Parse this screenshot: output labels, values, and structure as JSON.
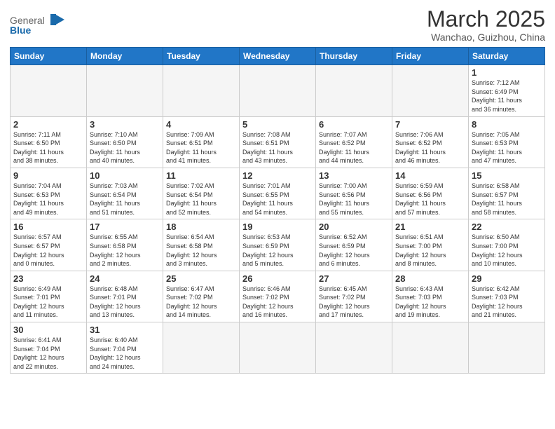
{
  "header": {
    "logo_general": "General",
    "logo_blue": "Blue",
    "month_title": "March 2025",
    "location": "Wanchao, Guizhou, China"
  },
  "weekdays": [
    "Sunday",
    "Monday",
    "Tuesday",
    "Wednesday",
    "Thursday",
    "Friday",
    "Saturday"
  ],
  "weeks": [
    [
      {
        "day": "",
        "info": ""
      },
      {
        "day": "",
        "info": ""
      },
      {
        "day": "",
        "info": ""
      },
      {
        "day": "",
        "info": ""
      },
      {
        "day": "",
        "info": ""
      },
      {
        "day": "",
        "info": ""
      },
      {
        "day": "1",
        "info": "Sunrise: 7:12 AM\nSunset: 6:49 PM\nDaylight: 11 hours\nand 36 minutes."
      }
    ],
    [
      {
        "day": "2",
        "info": "Sunrise: 7:11 AM\nSunset: 6:50 PM\nDaylight: 11 hours\nand 38 minutes."
      },
      {
        "day": "3",
        "info": "Sunrise: 7:10 AM\nSunset: 6:50 PM\nDaylight: 11 hours\nand 40 minutes."
      },
      {
        "day": "4",
        "info": "Sunrise: 7:09 AM\nSunset: 6:51 PM\nDaylight: 11 hours\nand 41 minutes."
      },
      {
        "day": "5",
        "info": "Sunrise: 7:08 AM\nSunset: 6:51 PM\nDaylight: 11 hours\nand 43 minutes."
      },
      {
        "day": "6",
        "info": "Sunrise: 7:07 AM\nSunset: 6:52 PM\nDaylight: 11 hours\nand 44 minutes."
      },
      {
        "day": "7",
        "info": "Sunrise: 7:06 AM\nSunset: 6:52 PM\nDaylight: 11 hours\nand 46 minutes."
      },
      {
        "day": "8",
        "info": "Sunrise: 7:05 AM\nSunset: 6:53 PM\nDaylight: 11 hours\nand 47 minutes."
      }
    ],
    [
      {
        "day": "9",
        "info": "Sunrise: 7:04 AM\nSunset: 6:53 PM\nDaylight: 11 hours\nand 49 minutes."
      },
      {
        "day": "10",
        "info": "Sunrise: 7:03 AM\nSunset: 6:54 PM\nDaylight: 11 hours\nand 51 minutes."
      },
      {
        "day": "11",
        "info": "Sunrise: 7:02 AM\nSunset: 6:54 PM\nDaylight: 11 hours\nand 52 minutes."
      },
      {
        "day": "12",
        "info": "Sunrise: 7:01 AM\nSunset: 6:55 PM\nDaylight: 11 hours\nand 54 minutes."
      },
      {
        "day": "13",
        "info": "Sunrise: 7:00 AM\nSunset: 6:56 PM\nDaylight: 11 hours\nand 55 minutes."
      },
      {
        "day": "14",
        "info": "Sunrise: 6:59 AM\nSunset: 6:56 PM\nDaylight: 11 hours\nand 57 minutes."
      },
      {
        "day": "15",
        "info": "Sunrise: 6:58 AM\nSunset: 6:57 PM\nDaylight: 11 hours\nand 58 minutes."
      }
    ],
    [
      {
        "day": "16",
        "info": "Sunrise: 6:57 AM\nSunset: 6:57 PM\nDaylight: 12 hours\nand 0 minutes."
      },
      {
        "day": "17",
        "info": "Sunrise: 6:55 AM\nSunset: 6:58 PM\nDaylight: 12 hours\nand 2 minutes."
      },
      {
        "day": "18",
        "info": "Sunrise: 6:54 AM\nSunset: 6:58 PM\nDaylight: 12 hours\nand 3 minutes."
      },
      {
        "day": "19",
        "info": "Sunrise: 6:53 AM\nSunset: 6:59 PM\nDaylight: 12 hours\nand 5 minutes."
      },
      {
        "day": "20",
        "info": "Sunrise: 6:52 AM\nSunset: 6:59 PM\nDaylight: 12 hours\nand 6 minutes."
      },
      {
        "day": "21",
        "info": "Sunrise: 6:51 AM\nSunset: 7:00 PM\nDaylight: 12 hours\nand 8 minutes."
      },
      {
        "day": "22",
        "info": "Sunrise: 6:50 AM\nSunset: 7:00 PM\nDaylight: 12 hours\nand 10 minutes."
      }
    ],
    [
      {
        "day": "23",
        "info": "Sunrise: 6:49 AM\nSunset: 7:01 PM\nDaylight: 12 hours\nand 11 minutes."
      },
      {
        "day": "24",
        "info": "Sunrise: 6:48 AM\nSunset: 7:01 PM\nDaylight: 12 hours\nand 13 minutes."
      },
      {
        "day": "25",
        "info": "Sunrise: 6:47 AM\nSunset: 7:02 PM\nDaylight: 12 hours\nand 14 minutes."
      },
      {
        "day": "26",
        "info": "Sunrise: 6:46 AM\nSunset: 7:02 PM\nDaylight: 12 hours\nand 16 minutes."
      },
      {
        "day": "27",
        "info": "Sunrise: 6:45 AM\nSunset: 7:02 PM\nDaylight: 12 hours\nand 17 minutes."
      },
      {
        "day": "28",
        "info": "Sunrise: 6:43 AM\nSunset: 7:03 PM\nDaylight: 12 hours\nand 19 minutes."
      },
      {
        "day": "29",
        "info": "Sunrise: 6:42 AM\nSunset: 7:03 PM\nDaylight: 12 hours\nand 21 minutes."
      }
    ],
    [
      {
        "day": "30",
        "info": "Sunrise: 6:41 AM\nSunset: 7:04 PM\nDaylight: 12 hours\nand 22 minutes."
      },
      {
        "day": "31",
        "info": "Sunrise: 6:40 AM\nSunset: 7:04 PM\nDaylight: 12 hours\nand 24 minutes."
      },
      {
        "day": "",
        "info": ""
      },
      {
        "day": "",
        "info": ""
      },
      {
        "day": "",
        "info": ""
      },
      {
        "day": "",
        "info": ""
      },
      {
        "day": "",
        "info": ""
      }
    ]
  ]
}
